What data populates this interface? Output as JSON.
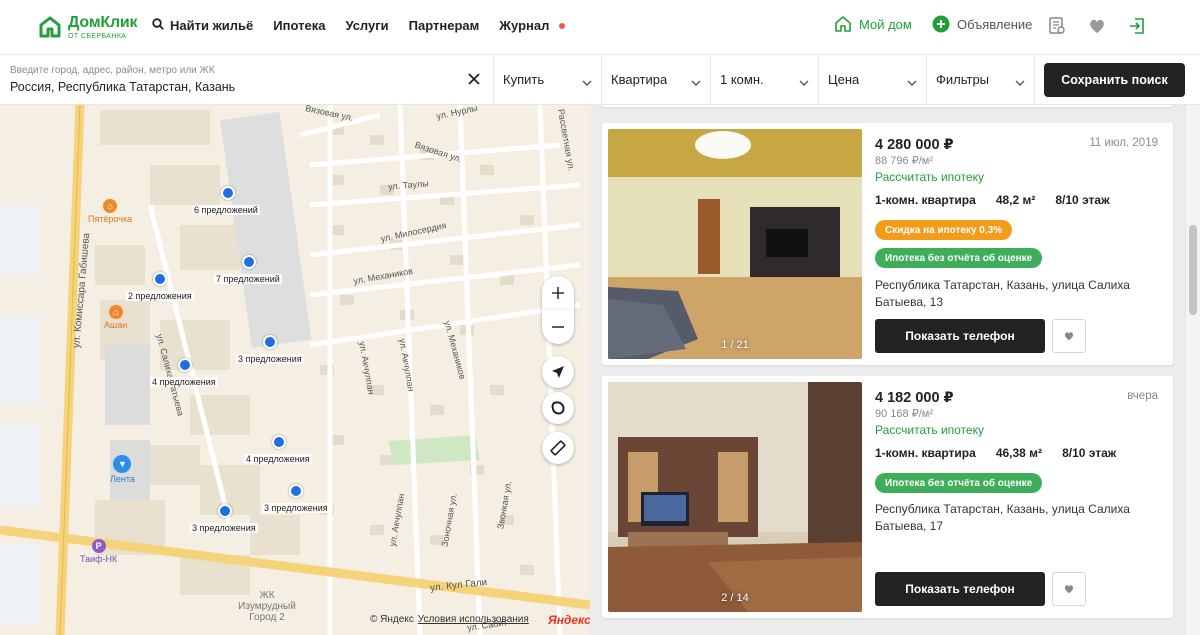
{
  "header": {
    "logo_main": "ДомКлик",
    "logo_sub": "ОТ СБЕРБАНКА",
    "nav": [
      {
        "label": "Найти жильё",
        "icon": "search-icon"
      },
      {
        "label": "Ипотека"
      },
      {
        "label": "Услуги"
      },
      {
        "label": "Партнерам"
      },
      {
        "label": "Журнал",
        "has_dot": true
      }
    ],
    "my_home": "Мой дом",
    "ad": "Объявление",
    "brand_color": "#21a038"
  },
  "filters": {
    "search_placeholder": "Введите город, адрес, район, метро или ЖК",
    "search_value": "Россия, Республика Татарстан, Казань",
    "deal": "Купить",
    "type": "Квартира",
    "rooms": "1 комн.",
    "price": "Цена",
    "more": "Фильтры",
    "save_label": "Сохранить поиск"
  },
  "map": {
    "streets": [
      "ул. Комиссара Габишева",
      "ул. Салиха Батыева",
      "Вязовая ул.",
      "ул. Нурлы",
      "Рассветная ул.",
      "ул. Таулы",
      "ул. Милосердия",
      "ул. Механиков",
      "ул. Механиков",
      "ул. Акчулпан",
      "ул. Акчулпан",
      "ул. Акчулпан",
      "Зоночная ул.",
      "Звонкая ул.",
      "ул. Кул Гали",
      "ул. Сабит"
    ],
    "clusters": [
      "6 предложений",
      "7 предложений",
      "2 предложения",
      "3 предложения",
      "4 предложения",
      "4 предложения",
      "3 предложения",
      "3 предложения"
    ],
    "pois": [
      "Пятёрочка",
      "Ашан",
      "Лента",
      "Таиф-НК"
    ],
    "district": "ЖК Изумрудный Город 2",
    "copyright": "© Яндекс",
    "terms": "Условия использования",
    "yandex": "Яндекс"
  },
  "listings": [
    {
      "price": "4 280 000 ₽",
      "price_per_m": "88 796 ₽/м²",
      "date": "11 июл. 2019",
      "calc": "Рассчитать ипотеку",
      "type": "1-комн. квартира",
      "area": "48,2 м²",
      "floor": "8/10 этаж",
      "badges": [
        "Скидка на ипотеку 0,3%",
        "Ипотека без отчёта об оценке"
      ],
      "address": "Республика Татарстан, Казань, улица Салиха Батыева, 13",
      "photo_counter": "1 / 21",
      "phone_label": "Показать телефон"
    },
    {
      "price": "4 182 000 ₽",
      "price_per_m": "90 168 ₽/м²",
      "date": "вчера",
      "calc": "Рассчитать ипотеку",
      "type": "1-комн. квартира",
      "area": "46,38 м²",
      "floor": "8/10 этаж",
      "badges": [
        "Ипотека без отчёта об оценке"
      ],
      "address": "Республика Татарстан, Казань, улица Салиха Батыева, 17",
      "photo_counter": "2 / 14",
      "phone_label": "Показать телефон"
    }
  ]
}
